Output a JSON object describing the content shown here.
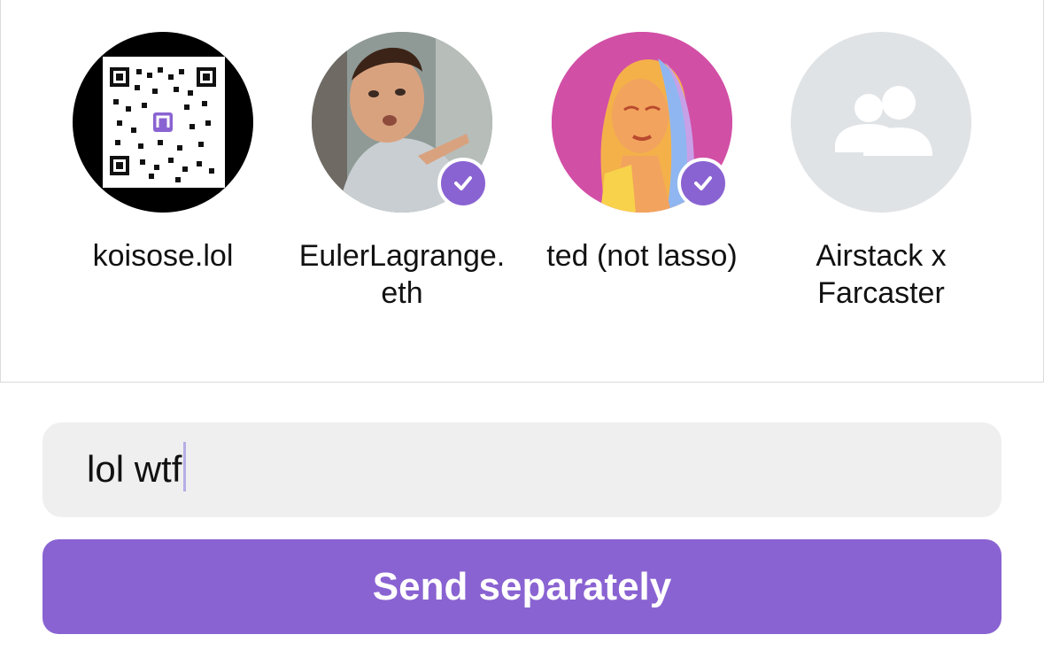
{
  "recipients": [
    {
      "name": "koisose.lol",
      "selected": false,
      "avatar": "qr-code"
    },
    {
      "name": "EulerLagrange.eth",
      "selected": true,
      "avatar": "person-photo"
    },
    {
      "name": "ted (not lasso)",
      "selected": true,
      "avatar": "illustrated-portrait"
    },
    {
      "name": "Airstack x Farcaster",
      "selected": false,
      "avatar": "group-icon"
    }
  ],
  "composer": {
    "value": "lol wtf"
  },
  "send_button": {
    "label": "Send separately"
  },
  "colors": {
    "accent": "#8a63d2",
    "input_bg": "#efefef",
    "placeholder_avatar": "#e0e3e6"
  }
}
